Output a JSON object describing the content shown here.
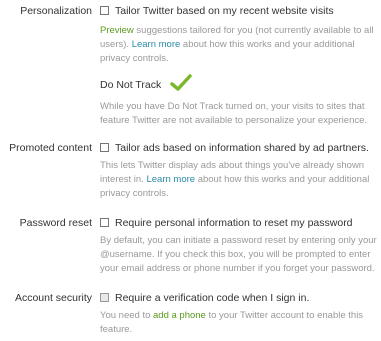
{
  "personalization": {
    "label": "Personalization",
    "option": "Tailor Twitter based on my recent website visits",
    "preview_link": "Preview",
    "desc_part1": " suggestions tailored for you (not currently available to all users). ",
    "learn_more": "Learn more",
    "desc_part2": " about how this works and your additional privacy controls.",
    "dnt_title": "Do Not Track",
    "dnt_desc": "While you have Do Not Track turned on, your visits to sites that feature Twitter are not available to personalize your experience."
  },
  "promoted": {
    "label": "Promoted content",
    "option": "Tailor ads based on information shared by ad partners.",
    "desc_part1": "This lets Twitter display ads about things you've already shown interest in. ",
    "learn_more": "Learn more",
    "desc_part2": " about how this works and your additional privacy controls."
  },
  "password": {
    "label": "Password reset",
    "option": "Require personal information to reset my password",
    "desc": "By default, you can initiate a password reset by entering only your @username. If you check this box, you will be prompted to enter your email address or phone number if you forget your password."
  },
  "security": {
    "label": "Account security",
    "option": "Require a verification code when I sign in.",
    "desc_part1": "You need to ",
    "add_phone": "add a phone",
    "desc_part2": " to your Twitter account to enable this feature."
  },
  "colors": {
    "link_blue": "#2a8aa8",
    "link_green": "#5a9a1e",
    "check_green": "#7cb82f"
  }
}
